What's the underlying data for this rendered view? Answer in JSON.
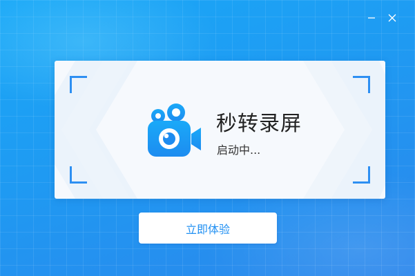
{
  "window": {
    "minimize_icon": "minimize-icon",
    "close_icon": "close-icon"
  },
  "splash": {
    "app_name": "秒转录屏",
    "status": "启动中...",
    "logo_icon": "video-camera-icon"
  },
  "actions": {
    "start_label": "立即体验"
  },
  "colors": {
    "accent": "#1f8ff2",
    "background": "#1f9af2",
    "card": "#f6f9fd"
  }
}
